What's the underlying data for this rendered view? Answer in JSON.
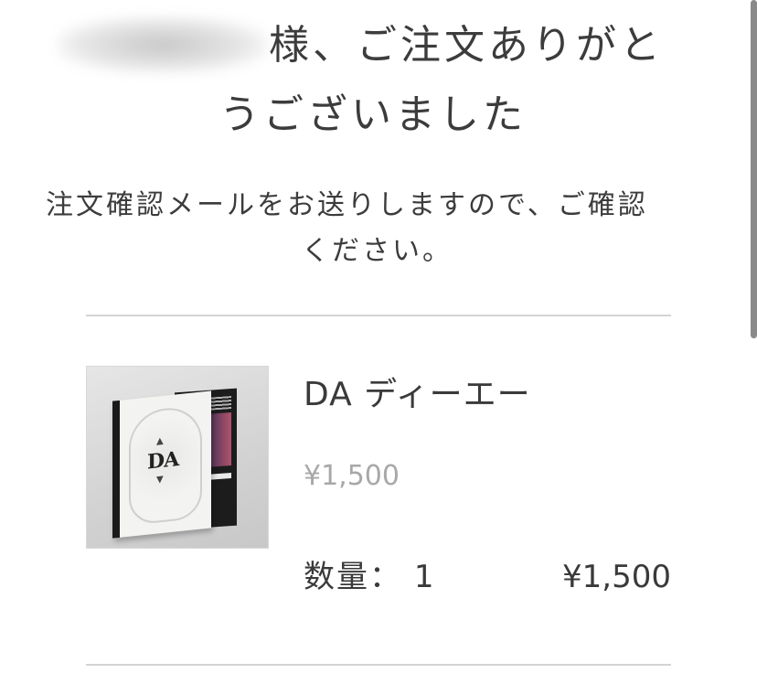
{
  "header": {
    "title_line1": "様、ご注文ありがと",
    "title_line2": "うございました"
  },
  "message": {
    "line1": "注文確認メールをお送りしますので、ご確認",
    "line2": "ください。"
  },
  "order_item": {
    "name": "DA ディーエー",
    "unit_price": "¥1,500",
    "quantity_label": "数量：",
    "quantity_value": "1",
    "line_total": "¥1,500",
    "image_logo_text": "DA"
  },
  "colors": {
    "text_primary": "#3a3a3a",
    "price_muted": "#a8a8a8",
    "divider": "#d4d4d4"
  }
}
